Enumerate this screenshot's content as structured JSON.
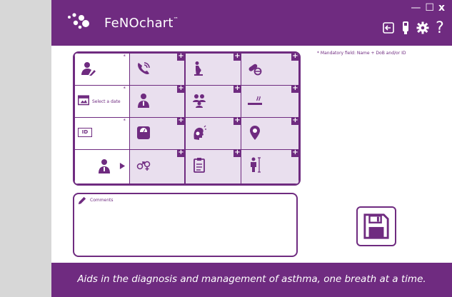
{
  "app": {
    "brand": "FeNOchart",
    "trademark": "™",
    "brand_color": "#6f2b80"
  },
  "window_controls": {
    "minimize": "—",
    "maximize": "☐",
    "close": "x"
  },
  "toolbar": {
    "icons": [
      "exit-icon",
      "device-icon",
      "settings-gear-icon",
      "help-icon"
    ],
    "help_label": "?"
  },
  "form": {
    "mandatory_note": "* Mandatory field: Name + DoB and/or ID",
    "date_placeholder": "Select a date",
    "id_label": "ID",
    "required_mark": "*",
    "add_mark": "+",
    "comments_label": "Comments",
    "rows": [
      [
        "patient-name-icon",
        "phone-icon",
        "pregnancy-icon",
        "medication-icon"
      ],
      [
        "date-of-birth-icon",
        "doctor-icon",
        "family-icon",
        "smoking-icon"
      ],
      [
        "id-card-icon",
        "weight-scale-icon",
        "symptoms-icon",
        "location-icon"
      ],
      [
        "clinician-icon",
        "gender-icon",
        "clipboard-icon",
        "height-icon"
      ]
    ]
  },
  "footer": {
    "tagline": "Aids in the diagnosis and management of asthma, one breath at a time."
  }
}
